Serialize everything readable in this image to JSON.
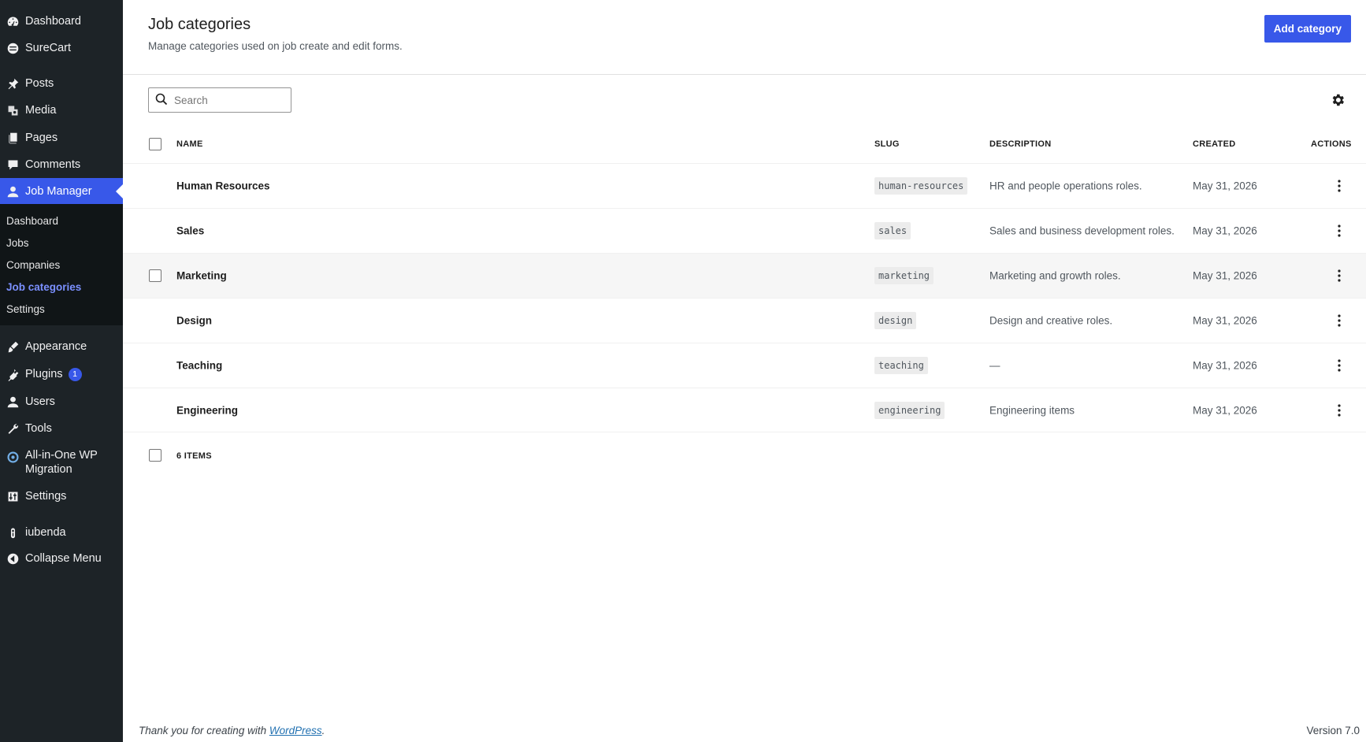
{
  "sidebar": {
    "items": [
      {
        "label": "Dashboard",
        "icon": "dashboard-icon"
      },
      {
        "label": "SureCart",
        "icon": "surecart-icon"
      },
      {
        "label": "Posts",
        "icon": "pin-icon"
      },
      {
        "label": "Media",
        "icon": "media-icon"
      },
      {
        "label": "Pages",
        "icon": "pages-icon"
      },
      {
        "label": "Comments",
        "icon": "comment-icon"
      },
      {
        "label": "Job Manager",
        "icon": "user-icon"
      },
      {
        "label": "Appearance",
        "icon": "brush-icon"
      },
      {
        "label": "Plugins",
        "icon": "plugin-icon",
        "badge": "1"
      },
      {
        "label": "Users",
        "icon": "users-icon"
      },
      {
        "label": "Tools",
        "icon": "wrench-icon"
      },
      {
        "label": "All-in-One WP Migration",
        "label_line1": "All-in-One WP",
        "label_line2": "Migration",
        "icon": "migration-icon"
      },
      {
        "label": "Settings",
        "icon": "settings-sliders-icon"
      },
      {
        "label": "iubenda",
        "icon": "iubenda-icon"
      },
      {
        "label": "Collapse Menu",
        "icon": "collapse-icon"
      }
    ],
    "submenu": [
      {
        "label": "Dashboard"
      },
      {
        "label": "Jobs"
      },
      {
        "label": "Companies"
      },
      {
        "label": "Job categories"
      },
      {
        "label": "Settings"
      }
    ]
  },
  "header": {
    "title": "Job categories",
    "subtitle": "Manage categories used on job create and edit forms.",
    "add_button": "Add category"
  },
  "search": {
    "placeholder": "Search"
  },
  "table": {
    "columns": {
      "name": "NAME",
      "slug": "SLUG",
      "description": "DESCRIPTION",
      "created": "CREATED",
      "actions": "ACTIONS"
    },
    "rows": [
      {
        "name": "Human Resources",
        "slug": "human-resources",
        "description": "HR and people operations roles.",
        "created": "May 31, 2026"
      },
      {
        "name": "Sales",
        "slug": "sales",
        "description": "Sales and business development roles.",
        "created": "May 31, 2026"
      },
      {
        "name": "Marketing",
        "slug": "marketing",
        "description": "Marketing and growth roles.",
        "created": "May 31, 2026"
      },
      {
        "name": "Design",
        "slug": "design",
        "description": "Design and creative roles.",
        "created": "May 31, 2026"
      },
      {
        "name": "Teaching",
        "slug": "teaching",
        "description": "—",
        "created": "May 31, 2026"
      },
      {
        "name": "Engineering",
        "slug": "engineering",
        "description": "Engineering items",
        "created": "May 31, 2026"
      }
    ],
    "count_label": "6 ITEMS"
  },
  "footer": {
    "thanks_prefix": "Thank you for creating with ",
    "thanks_link": "WordPress",
    "thanks_suffix": ".",
    "version": "Version 7.0"
  },
  "colors": {
    "accent": "#3858e9",
    "sidebar_bg": "#1d2327",
    "submenu_bg": "#101517",
    "current_sub": "#7b90ff"
  }
}
